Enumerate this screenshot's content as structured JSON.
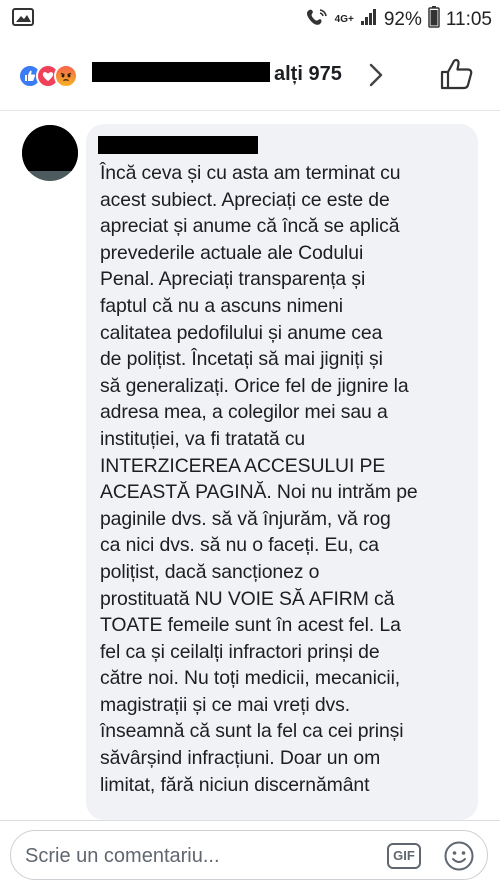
{
  "status_bar": {
    "network": "4G+",
    "battery": "92%",
    "time": "11:05"
  },
  "reactions": {
    "icons": [
      "like-icon",
      "love-icon",
      "angry-icon"
    ],
    "others_text": "alți 975"
  },
  "comment": {
    "lines": [
      "Încă ceva și cu asta am terminat cu",
      "acest subiect. Apreciați ce este de",
      "apreciat și anume că încă se aplică",
      "prevederile actuale ale Codului",
      "Penal. Apreciați transparența și",
      "faptul că nu a ascuns nimeni",
      "calitatea pedofilului și anume cea",
      "de polițist. Încetați să mai jigniți și",
      "să generalizați. Orice fel de jignire la",
      "adresa mea, a colegilor mei sau a",
      "instituției, va fi tratată cu",
      "INTERZICEREA ACCESULUI PE",
      "ACEASTĂ PAGINĂ. Noi nu intrăm pe",
      "paginile dvs. să vă înjurăm, vă rog",
      "ca nici dvs. să nu o faceți. Eu, ca",
      "polițist, dacă sancționez o",
      "prostituată NU VOIE SĂ AFIRM că",
      "TOATE femeile sunt în acest fel. La",
      "fel ca și ceilalți infractori prinși de",
      "către noi. Nu toți medicii, mecanicii,",
      "magistrații și ce mai vreți dvs.",
      "înseamnă că sunt la fel ca cei prinși",
      "săvârșind infracțiuni. Doar un om",
      "limitat, fără niciun discernământ"
    ]
  },
  "composer": {
    "placeholder": "Scrie un comentariu...",
    "gif_label": "GIF"
  }
}
